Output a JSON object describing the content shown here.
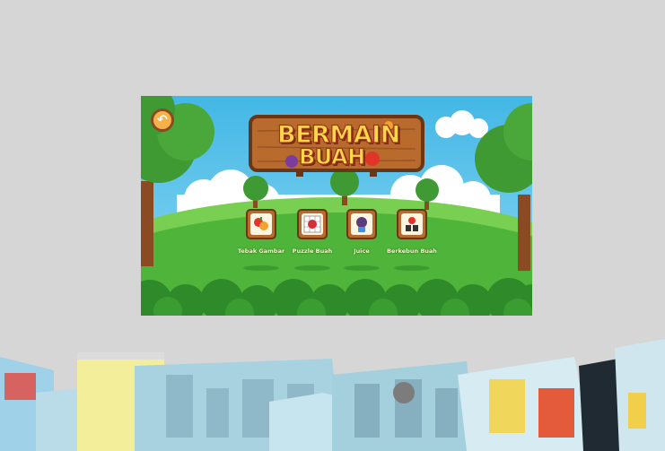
{
  "game": {
    "title_line1": "BERMAIN",
    "title_line2": "BUAH",
    "back_button_icon": "back-arrow-icon",
    "menu_items": [
      {
        "label": "Tebak Gambar",
        "icon": "fruit-collage-icon"
      },
      {
        "label": "Puzzle Buah",
        "icon": "puzzle-grid-icon"
      },
      {
        "label": "Juice",
        "icon": "juice-blender-icon"
      },
      {
        "label": "Berkebun Buah",
        "icon": "gardening-icon"
      }
    ]
  },
  "colors": {
    "page_background": "#d6d6d6",
    "sky": "#5ec5ea",
    "grass": "#4fb53a",
    "wood": "#b96a2d",
    "title_text": "#ffd84a"
  }
}
